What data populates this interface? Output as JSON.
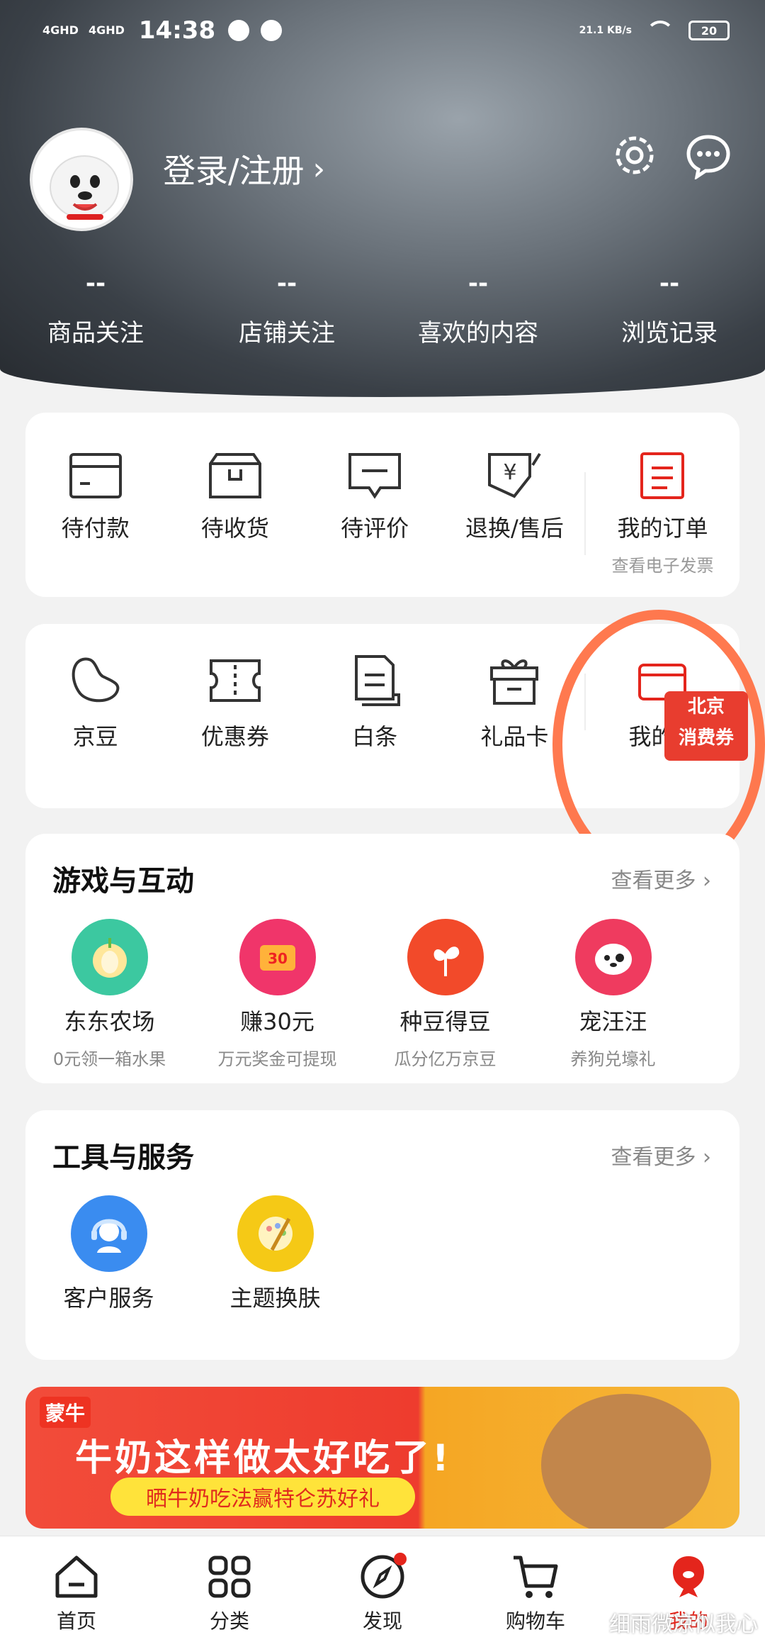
{
  "status_bar": {
    "signal1": "4GHD",
    "signal2": "4GHD",
    "time": "14:38",
    "speed": "21.1 KB/s",
    "battery": "20"
  },
  "header": {
    "login_label": "登录/注册",
    "stats": [
      {
        "value": "--",
        "label": "商品关注"
      },
      {
        "value": "--",
        "label": "店铺关注"
      },
      {
        "value": "--",
        "label": "喜欢的内容"
      },
      {
        "value": "--",
        "label": "浏览记录"
      }
    ]
  },
  "orders": {
    "items": [
      {
        "label": "待付款",
        "icon": "wallet-icon"
      },
      {
        "label": "待收货",
        "icon": "box-icon"
      },
      {
        "label": "待评价",
        "icon": "comment-icon"
      },
      {
        "label": "退换/售后",
        "icon": "return-icon"
      }
    ],
    "my_orders": {
      "label": "我的订单",
      "sub": "查看电子发票",
      "icon": "order-list-icon"
    }
  },
  "assets": {
    "items": [
      {
        "label": "京豆",
        "icon": "bean-icon"
      },
      {
        "label": "优惠券",
        "icon": "coupon-icon"
      },
      {
        "label": "白条",
        "icon": "baitiao-icon"
      },
      {
        "label": "礼品卡",
        "icon": "gift-card-icon"
      }
    ],
    "wallet": {
      "label": "我的钱",
      "icon": "wallet-icon"
    },
    "badge_line1": "北京",
    "badge_line2": "消费券"
  },
  "games": {
    "title": "游戏与互动",
    "more": "查看更多",
    "items": [
      {
        "label": "东东农场",
        "sub": "0元领一箱水果",
        "color": "#3cc8a0",
        "icon": "apple-icon"
      },
      {
        "label": "赚30元",
        "sub": "万元奖金可提现",
        "color": "#f0356a",
        "icon": "cash-30-icon"
      },
      {
        "label": "种豆得豆",
        "sub": "瓜分亿万京豆",
        "color": "#f24a2a",
        "icon": "sprout-icon"
      },
      {
        "label": "宠汪汪",
        "sub": "养狗兑壕礼",
        "color": "#ef3b5f",
        "icon": "dog-icon"
      }
    ]
  },
  "tools": {
    "title": "工具与服务",
    "more": "查看更多",
    "items": [
      {
        "label": "客户服务",
        "color": "#3a8cf0",
        "icon": "headset-icon"
      },
      {
        "label": "主题换肤",
        "color": "#f5c916",
        "icon": "palette-icon"
      }
    ]
  },
  "banner": {
    "brand": "蒙牛",
    "headline": "牛奶这样做太好吃了!",
    "pill": "晒牛奶吃法赢特仑苏好礼"
  },
  "nav": {
    "items": [
      {
        "label": "首页",
        "icon": "home-icon"
      },
      {
        "label": "分类",
        "icon": "grid-icon"
      },
      {
        "label": "发现",
        "icon": "compass-icon"
      },
      {
        "label": "购物车",
        "icon": "cart-icon"
      },
      {
        "label": "我的",
        "icon": "profile-icon"
      }
    ]
  },
  "watermark": "细雨微凉似我心"
}
